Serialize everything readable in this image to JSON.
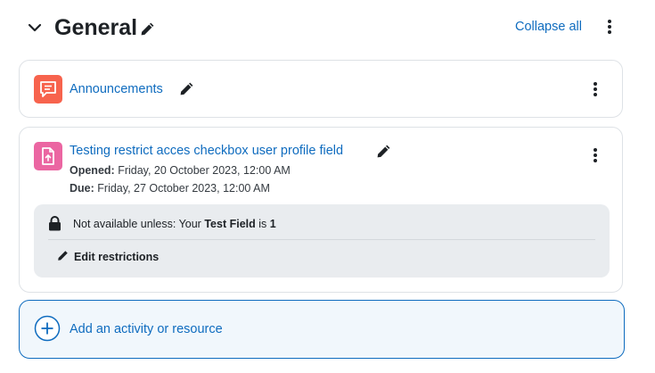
{
  "section": {
    "title": "General",
    "collapse_label": "Collapse all",
    "icons": {
      "toggle": "chevron-down-icon",
      "edit": "pencil-icon",
      "menu": "kebab-menu-icon"
    }
  },
  "activities": [
    {
      "type_icon": "forum-icon",
      "icon_color": "#f7634d",
      "name": "Announcements"
    },
    {
      "type_icon": "assignment-icon",
      "icon_color": "#eb66a2",
      "name": "Testing restrict acces checkbox user profile field",
      "opened_label": "Opened:",
      "opened_value": "Friday, 20 October 2023, 12:00 AM",
      "due_label": "Due:",
      "due_value": "Friday, 27 October 2023, 12:00 AM",
      "restriction": {
        "prefix": "Not available unless: Your",
        "field": "Test Field",
        "middle": "is",
        "value": "1",
        "edit_label": "Edit restrictions"
      }
    }
  ],
  "add_activity": {
    "label": "Add an activity or resource"
  },
  "colors": {
    "link": "#0f6cbf",
    "text": "#1d2125",
    "restriction_bg": "#e9ecef",
    "add_bg": "#f1f7fc"
  }
}
